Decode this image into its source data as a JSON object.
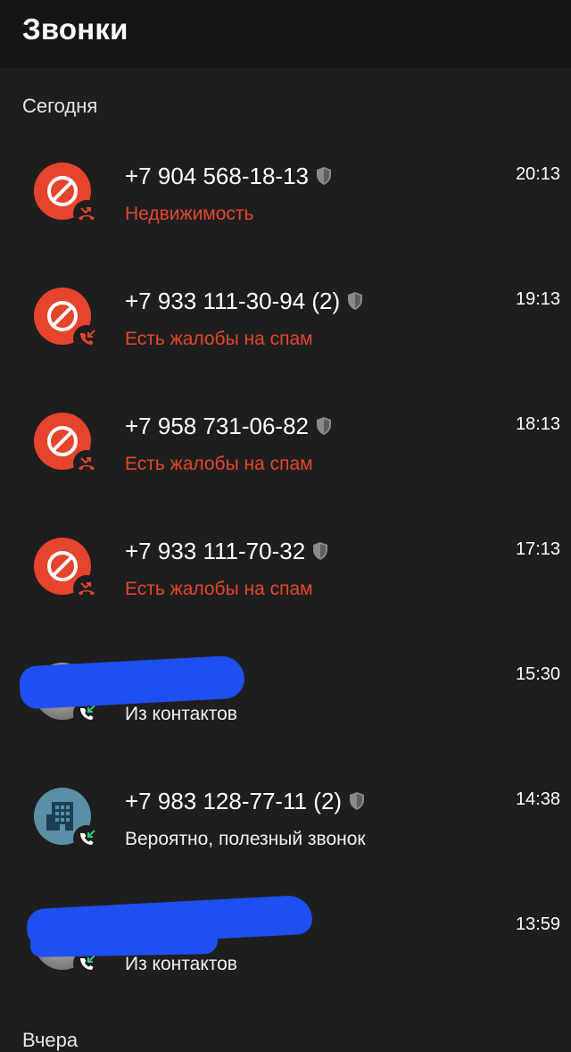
{
  "header": {
    "title": "Звонки"
  },
  "sections": {
    "today": "Сегодня",
    "yesterday": "Вчера"
  },
  "calls": [
    {
      "number": "+7 904 568-18-13",
      "label": "Недвижимость",
      "time": "20:13",
      "avatar": "block-icon",
      "direction": "missed-call-icon",
      "label_color": "#e5452c"
    },
    {
      "number": "+7 933 111-30-94 (2)",
      "label": "Есть жалобы на спам",
      "time": "19:13",
      "avatar": "block-icon",
      "direction": "incoming-call-icon",
      "label_color": "#e5452c"
    },
    {
      "number": "+7 958 731-06-82",
      "label": "Есть жалобы на спам",
      "time": "18:13",
      "avatar": "block-icon",
      "direction": "missed-call-icon",
      "label_color": "#e5452c"
    },
    {
      "number": "+7 933 111-70-32",
      "label": "Есть жалобы на спам",
      "time": "17:13",
      "avatar": "block-icon",
      "direction": "missed-call-icon",
      "label_color": "#e5452c"
    },
    {
      "number": "",
      "label": "Из контактов",
      "time": "15:30",
      "avatar": "contact-photo",
      "direction": "incoming-call-icon",
      "label_color": "#f0f0f0"
    },
    {
      "number": "+7 983 128-77-11 (2)",
      "label": "Вероятно, полезный звонок",
      "time": "14:38",
      "avatar": "building-icon",
      "direction": "incoming-call-icon",
      "label_color": "#f0f0f0"
    },
    {
      "number": "",
      "label": "Из контактов",
      "time": "13:59",
      "avatar": "contact-photo",
      "direction": "incoming-call-icon",
      "label_color": "#f0f0f0"
    }
  ],
  "colors": {
    "spam_red": "#e5452c",
    "incoming_green": "#2ecc71",
    "background": "#1e1e1e",
    "redaction_blue": "#1f4ff0"
  }
}
